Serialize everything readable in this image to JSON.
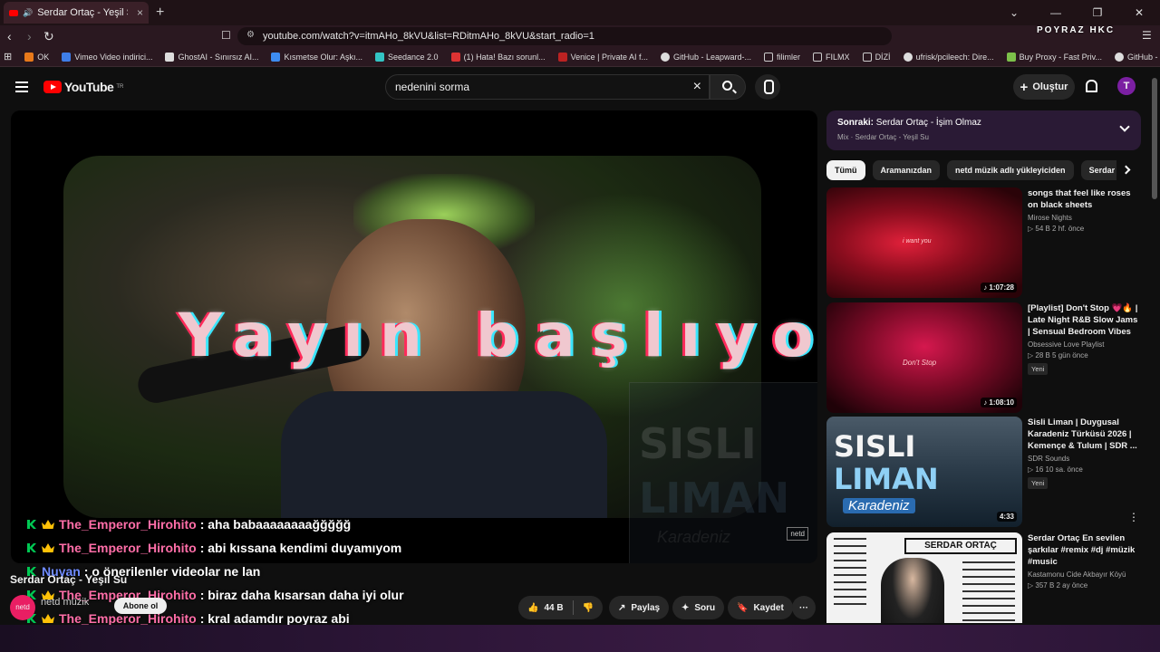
{
  "browser": {
    "tab_title": "Serdar Ortaç - Yeşil Su - YouT",
    "url": "youtube.com/watch?v=itmAHo_8kVU&list=RDitmAHo_8kVU&start_radio=1",
    "brand": "POYRAZ HKC",
    "bookmarks": [
      "OK",
      "Vimeo Video indirici...",
      "GhostAI - Sınırsız AI...",
      "Kısmetse Olur: Aşkı...",
      "Seedance 2.0",
      "(1) Hata! Bazı sorunl...",
      "Venice | Private AI f...",
      "GitHub - Leapward-...",
      "filimler",
      "FILMX",
      "DİZİ",
      "ufrisk/pcileech: Dire...",
      "Buy Proxy - Fast Priv...",
      "GitHub - xmkg/ko-t..."
    ]
  },
  "youtube": {
    "logo": "YouTube",
    "logo_sup": "TR",
    "search_value": "nedenini sorma",
    "create_label": "Oluştur",
    "avatar_letter": "T"
  },
  "player": {
    "overlay_text": "Yayın başlıyor...",
    "thumb_line1": "SISLI",
    "thumb_line2": "LIMAN",
    "thumb_line3": "Karadeniz",
    "netd_badge": "netd"
  },
  "chat": [
    {
      "user": "The_Emperor_Hirohito",
      "color": "#ff6ea8",
      "msg": ": aha babaaaaaaaağğğğğ"
    },
    {
      "user": "The_Emperor_Hirohito",
      "color": "#ff6ea8",
      "msg": ": abi kıssana kendimi duyamıyom"
    },
    {
      "user": "Nuyan",
      "color": "#6f8bff",
      "msg": ": o önerilenler videolar ne lan"
    },
    {
      "user": "The_Emperor_Hirohito",
      "color": "#ff6ea8",
      "msg": ": biraz daha kısarsan daha iyi olur"
    },
    {
      "user": "The_Emperor_Hirohito",
      "color": "#ff6ea8",
      "msg": ": kral adamdır poyraz abi"
    }
  ],
  "video": {
    "title": "Serdar Ortaç - Yeşil Su",
    "channel": "netd müzik",
    "channel_avatar": "netd",
    "subscribe": "Abone ol",
    "likes": "44 B",
    "share": "Paylaş",
    "ask": "Soru",
    "save": "Kaydet",
    "more": "···"
  },
  "sidebar": {
    "next_label": "Sonraki:",
    "next_title": "Serdar Ortaç - İşim Olmaz",
    "next_sub": "Mix · Serdar Ortaç - Yeşil Su",
    "chips": [
      "Tümü",
      "Aramanızdan",
      "netd müzik adlı yükleyiciden",
      "Serdar Ortaç"
    ],
    "items": [
      {
        "title": "songs that feel like roses on black sheets",
        "channel": "Mirose Nights",
        "stats": "▷ 54 B   2 hf. önce",
        "duration": "♪ 1:07:28",
        "badge": "",
        "thumb_text": "i want you"
      },
      {
        "title": "[Playlist] Don't Stop 💗🔥 | Late Night R&B Slow Jams | Sensual Bedroom Vibes",
        "channel": "Obsessive Love Playlist",
        "stats": "▷ 28 B   5 gün önce",
        "duration": "♪ 1:08:10",
        "badge": "Yeni",
        "thumb_text": "Don't Stop"
      },
      {
        "title": "Sisli Liman | Duygusal Karadeniz Türküsü 2026 | Kemençe & Tulum | SDR ...",
        "channel": "SDR Sounds",
        "stats": "▷ 16   10 sa. önce",
        "duration": "4:33",
        "badge": "Yeni",
        "thumb_text": "SISLI"
      },
      {
        "title": "Serdar Ortaç En sevilen şarkılar #remix #dj #müzik #music",
        "channel": "Kastamonu Cide Akbayır Köyü",
        "stats": "▷ 357 B   2 ay önce",
        "duration": "",
        "badge": "",
        "thumb_text": "SERDAR ORTAÇ"
      }
    ]
  }
}
